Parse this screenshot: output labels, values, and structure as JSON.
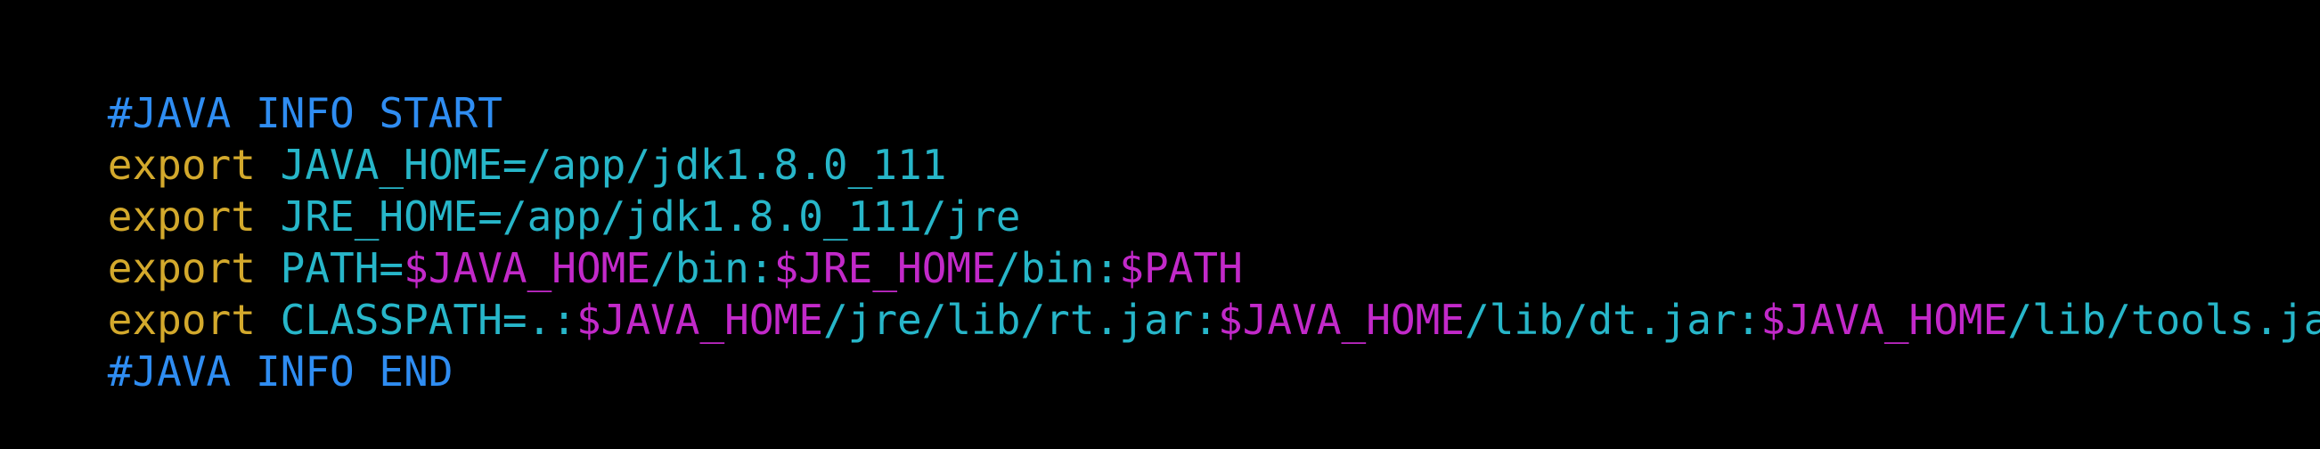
{
  "terminal": {
    "colors": {
      "background": "#000000",
      "comment": "#2f8df2",
      "keyword": "#d3a92c",
      "text": "#27b6c9",
      "variable": "#c229c9"
    },
    "lines": [
      {
        "segments": [
          "#JAVA INFO START"
        ]
      },
      {
        "segments": [
          "export",
          " JAVA_HOME=/app/jdk1.8.0_111"
        ]
      },
      {
        "segments": [
          "export",
          " JRE_HOME=/app/jdk1.8.0_111/jre"
        ]
      },
      {
        "segments": [
          "export",
          " PATH=",
          "$JAVA_HOME",
          "/bin:",
          "$JRE_HOME",
          "/bin:",
          "$PATH"
        ]
      },
      {
        "segments": [
          "export",
          " CLASSPATH=.:",
          "$JAVA_HOME",
          "/jre/lib/rt.jar:",
          "$JAVA_HOME",
          "/lib/dt.jar:",
          "$JAVA_HOME",
          "/lib/tools.jar"
        ]
      },
      {
        "segments": [
          "#JAVA INFO END"
        ]
      }
    ]
  }
}
